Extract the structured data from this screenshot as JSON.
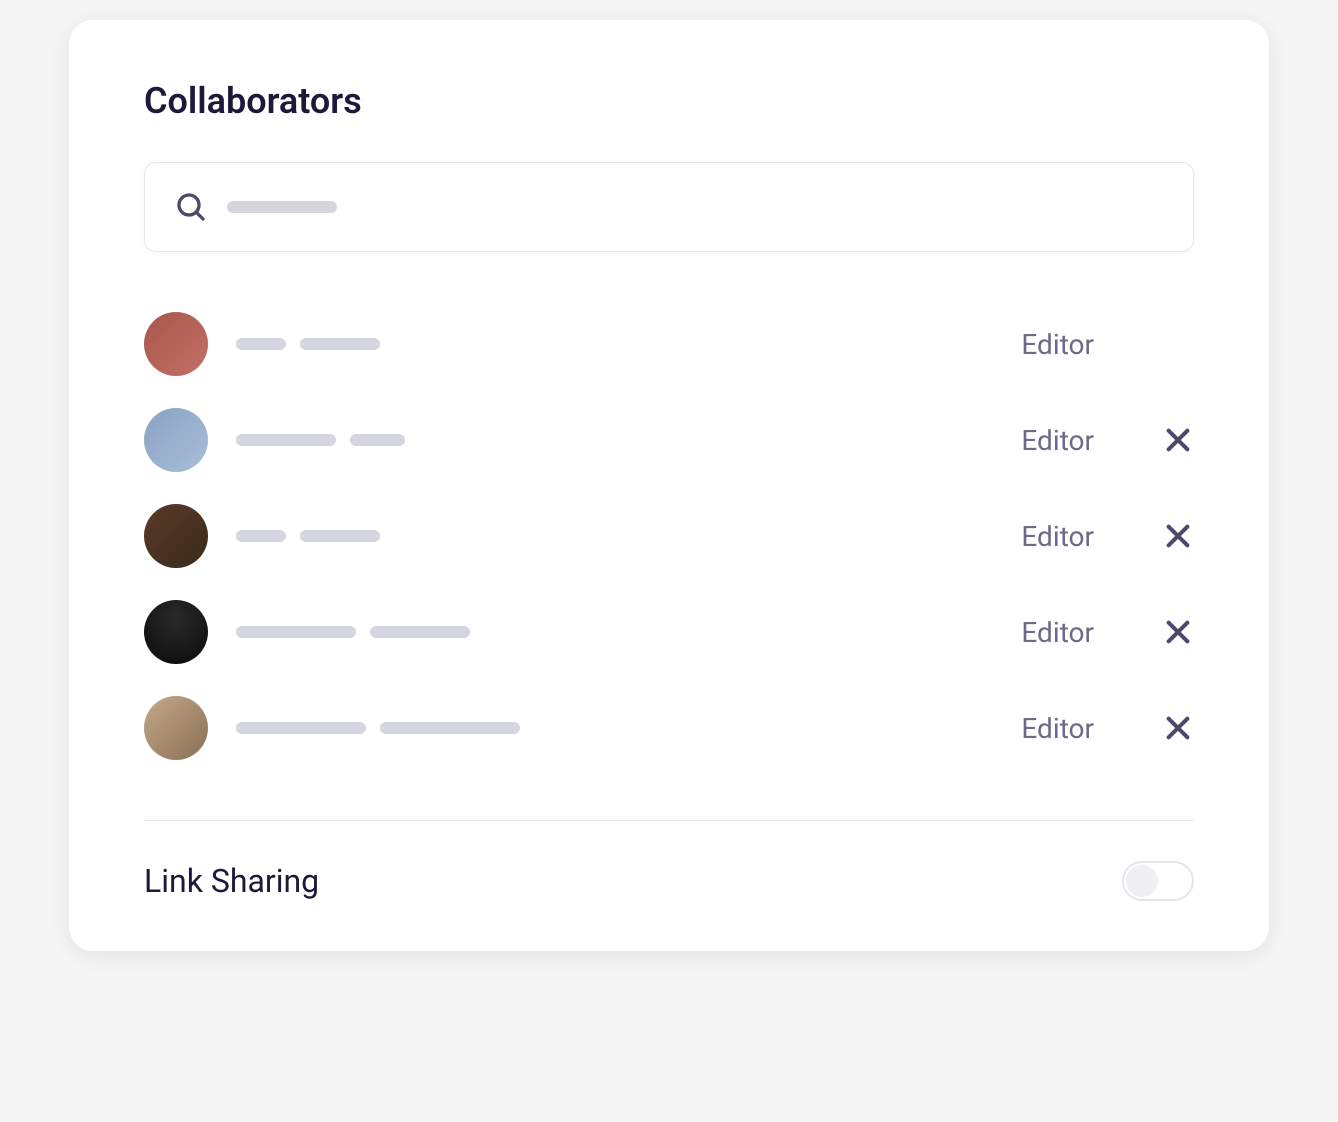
{
  "title": "Collaborators",
  "search": {
    "placeholder_width": 110
  },
  "collaborators": [
    {
      "role": "Editor",
      "removable": false,
      "name_bars": [
        50,
        80
      ]
    },
    {
      "role": "Editor",
      "removable": true,
      "name_bars": [
        100,
        55
      ]
    },
    {
      "role": "Editor",
      "removable": true,
      "name_bars": [
        50,
        80
      ]
    },
    {
      "role": "Editor",
      "removable": true,
      "name_bars": [
        120,
        100
      ]
    },
    {
      "role": "Editor",
      "removable": true,
      "name_bars": [
        130,
        140
      ]
    }
  ],
  "link_sharing": {
    "label": "Link Sharing",
    "enabled": false
  }
}
